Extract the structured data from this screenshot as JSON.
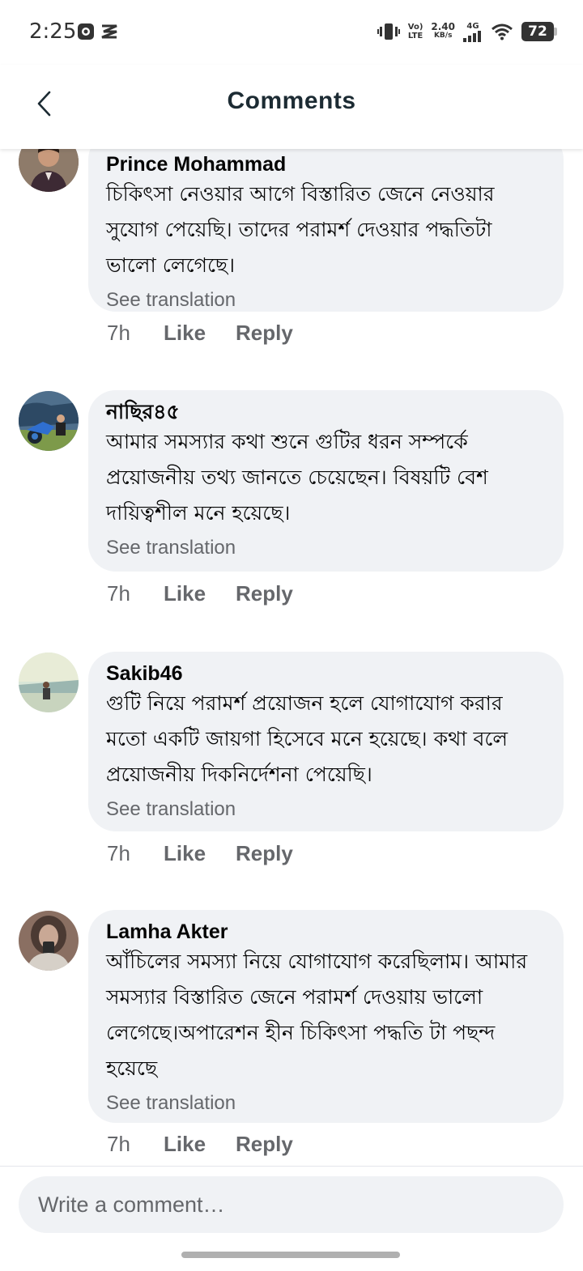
{
  "status_bar": {
    "time": "2:25",
    "network_volte": "Vo)",
    "network_lte": "LTE",
    "speed_value": "2.40",
    "speed_unit": "KB/s",
    "signal_type": "4G",
    "battery": "72"
  },
  "header": {
    "title": "Comments",
    "back_icon": "chevron-left-icon"
  },
  "comments": [
    {
      "author": "Prince Mohammad",
      "text": "চিকিৎসা নেওয়ার আগে বিস্তারিত জেনে নেওয়ার সুযোগ পেয়েছি। তাদের পরামর্শ দেওয়ার পদ্ধতিটা ভালো লেগেছে।",
      "translation_label": "See translation",
      "time": "7h",
      "like_label": "Like",
      "reply_label": "Reply"
    },
    {
      "author": "নাছির৪৫",
      "text": "আমার সমস্যার কথা শুনে গুটির ধরন সম্পর্কে প্রয়োজনীয় তথ্য জানতে চেয়েছেন। বিষয়টি বেশ দায়িত্বশীল মনে হয়েছে।",
      "translation_label": "See translation",
      "time": "7h",
      "like_label": "Like",
      "reply_label": "Reply"
    },
    {
      "author": "Sakib46",
      "text": "গুটি নিয়ে পরামর্শ প্রয়োজন হলে যোগাযোগ করার মতো একটি জায়গা হিসেবে মনে হয়েছে। কথা বলে প্রয়োজনীয় দিকনির্দেশনা পেয়েছি।",
      "translation_label": "See translation",
      "time": "7h",
      "like_label": "Like",
      "reply_label": "Reply"
    },
    {
      "author": "Lamha Akter",
      "text": "আঁচিলের সমস্যা নিয়ে যোগাযোগ করেছিলাম। আমার সমস্যার বিস্তারিত জেনে পরামর্শ দেওয়ায় ভালো লেগেছে।অপারেশন হীন চিকিৎসা পদ্ধতি টা পছন্দ হয়েছে",
      "translation_label": "See translation",
      "time": "7h",
      "like_label": "Like",
      "reply_label": "Reply"
    }
  ],
  "composer": {
    "placeholder": "Write a comment…"
  }
}
